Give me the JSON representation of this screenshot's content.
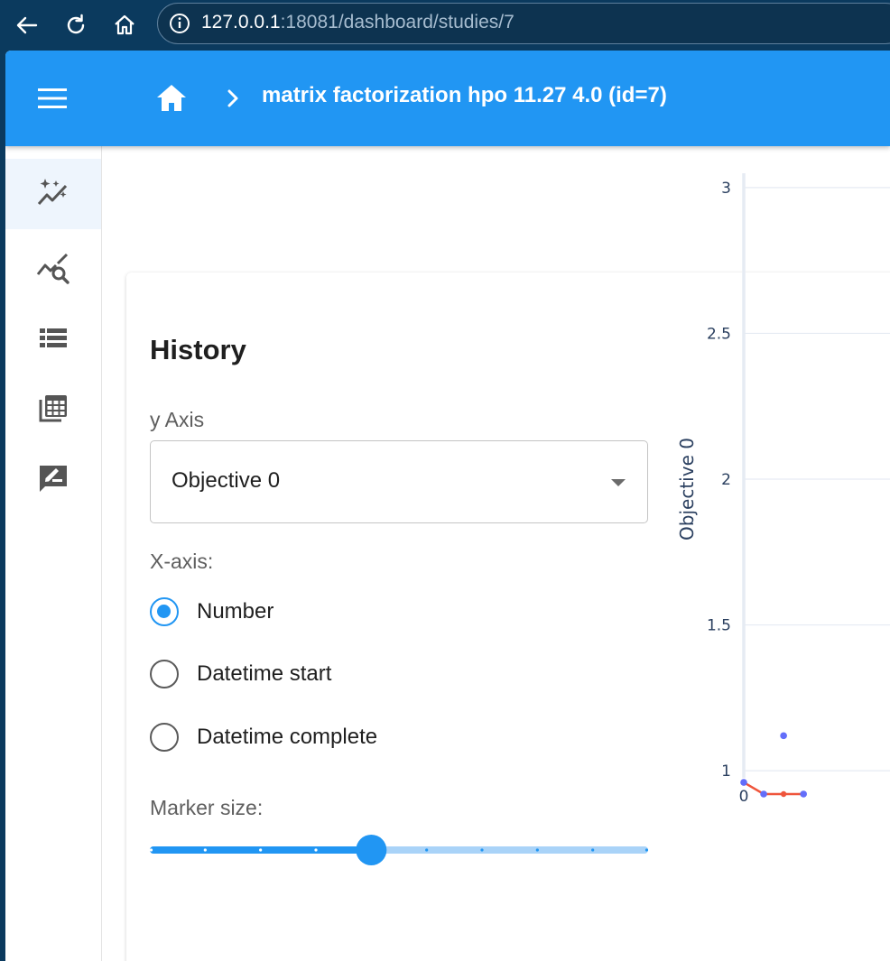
{
  "browser": {
    "url_host": "127.0.0.1",
    "url_rest": ":18081/dashboard/studies/7"
  },
  "app_bar": {
    "study_title": "matrix factorization hpo 11.27 4.0 (id=7)"
  },
  "sidebar": {
    "items": [
      {
        "icon": "auto-graph-icon",
        "active": true
      },
      {
        "icon": "query-stats-icon",
        "active": false
      },
      {
        "icon": "list-icon",
        "active": false
      },
      {
        "icon": "table-icon",
        "active": false
      },
      {
        "icon": "rate-review-icon",
        "active": false
      }
    ]
  },
  "history": {
    "title": "History",
    "y_axis_label": "y Axis",
    "y_axis_value": "Objective 0",
    "x_axis_label": "X-axis:",
    "x_axis_options": [
      "Number",
      "Datetime start",
      "Datetime complete"
    ],
    "x_axis_selected": 0,
    "marker_size_label": "Marker size:",
    "marker_size": {
      "min": 0,
      "max": 9,
      "value": 4
    }
  },
  "colors": {
    "primary": "#2196f3",
    "best_line": "#ef553b",
    "points": "#636efa"
  },
  "chart_data": {
    "type": "scatter",
    "ylabel": "Objective 0",
    "y_ticks": [
      1,
      1.5,
      2,
      2.5,
      3
    ],
    "x_ticks": [
      0
    ],
    "ylim": [
      0.79,
      3.08
    ],
    "xlim": [
      0,
      3.3
    ],
    "series": [
      {
        "x": [
          0,
          1,
          2,
          3
        ],
        "y": [
          0.96,
          0.92,
          1.12,
          0.92
        ]
      },
      {
        "x": [
          0,
          1,
          2,
          3
        ],
        "y": [
          0.96,
          0.92,
          0.92,
          0.92
        ]
      }
    ]
  }
}
